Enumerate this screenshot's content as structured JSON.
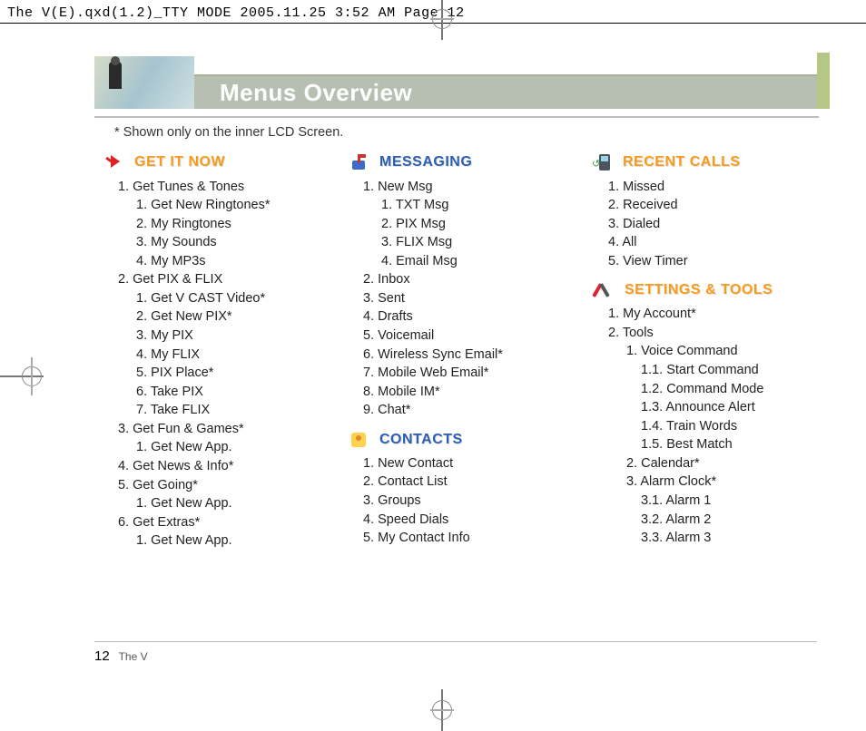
{
  "print_header": "The V(E).qxd(1.2)_TTY MODE  2005.11.25  3:52 AM  Page 12",
  "page_title": "Menus Overview",
  "note": "*  Shown only on the inner LCD Screen.",
  "footer": {
    "page_number": "12",
    "book_name": "The V"
  },
  "sections": {
    "get_it_now": {
      "label": "GET IT NOW",
      "items": [
        "1. Get Tunes & Tones",
        "  1. Get New Ringtones*",
        "  2. My Ringtones",
        "  3. My Sounds",
        "  4. My MP3s",
        "2. Get PIX & FLIX",
        "  1. Get V CAST Video*",
        "  2. Get New PIX*",
        "  3. My PIX",
        "  4. My FLIX",
        "  5. PIX Place*",
        "  6. Take PIX",
        "  7. Take FLIX",
        "3. Get Fun & Games*",
        "  1. Get New App.",
        "4. Get News & Info*",
        "5. Get Going*",
        "  1. Get New App.",
        "6. Get Extras*",
        "  1. Get New App."
      ]
    },
    "messaging": {
      "label": "MESSAGING",
      "items": [
        "1. New Msg",
        "  1. TXT Msg",
        "  2. PIX Msg",
        "  3. FLIX Msg",
        "  4. Email Msg",
        "2. Inbox",
        "3. Sent",
        "4. Drafts",
        "5. Voicemail",
        "6. Wireless Sync Email*",
        "7. Mobile Web Email*",
        "8. Mobile IM*",
        "9. Chat*"
      ]
    },
    "contacts": {
      "label": "CONTACTS",
      "items": [
        "1. New Contact",
        "2. Contact List",
        "3. Groups",
        "4. Speed Dials",
        "5. My Contact Info"
      ]
    },
    "recent_calls": {
      "label": "RECENT CALLS",
      "items": [
        "1. Missed",
        "2. Received",
        "3. Dialed",
        "4. All",
        "5. View Timer"
      ]
    },
    "settings_tools": {
      "label": "SETTINGS & TOOLS",
      "items": [
        "1. My Account*",
        "2. Tools",
        "  1. Voice Command",
        "    1.1. Start Command",
        "    1.2. Command Mode",
        "    1.3. Announce Alert",
        "    1.4. Train Words",
        "    1.5. Best Match",
        "  2. Calendar*",
        "  3. Alarm Clock*",
        "    3.1. Alarm 1",
        "    3.2. Alarm 2",
        "    3.3. Alarm 3"
      ]
    }
  }
}
